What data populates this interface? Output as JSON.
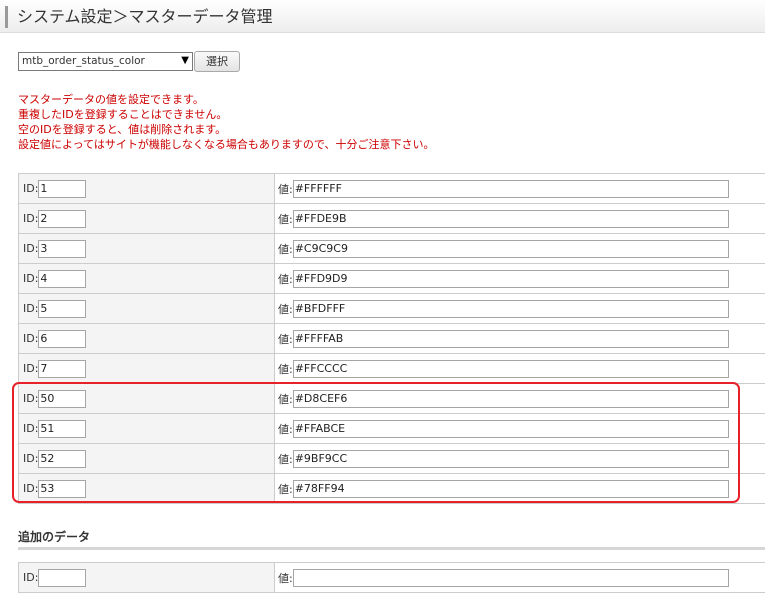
{
  "header": {
    "title": "システム設定＞マスターデータ管理"
  },
  "master_select": {
    "selected": "mtb_order_status_color",
    "button_label": "選択"
  },
  "notice": {
    "lines": [
      "マスターデータの値を設定できます。",
      "重複したIDを登録することはできません。",
      "空のIDを登録すると、値は削除されます。",
      "設定値によってはサイトが機能しなくなる場合もありますので、十分ご注意下さい。"
    ]
  },
  "labels": {
    "id": "ID:",
    "value": "値:"
  },
  "rows": [
    {
      "id": "1",
      "value": "#FFFFFF"
    },
    {
      "id": "2",
      "value": "#FFDE9B"
    },
    {
      "id": "3",
      "value": "#C9C9C9"
    },
    {
      "id": "4",
      "value": "#FFD9D9"
    },
    {
      "id": "5",
      "value": "#BFDFFF"
    },
    {
      "id": "6",
      "value": "#FFFFAB"
    },
    {
      "id": "7",
      "value": "#FFCCCC"
    },
    {
      "id": "50",
      "value": "#D8CEF6"
    },
    {
      "id": "51",
      "value": "#FFABCE"
    },
    {
      "id": "52",
      "value": "#9BF9CC"
    },
    {
      "id": "53",
      "value": "#78FF94"
    }
  ],
  "add_section": {
    "title": "追加のデータ",
    "id": "",
    "value": ""
  },
  "colors": {
    "notice": "#cc0000",
    "highlight": "#e8202a",
    "id_column_bg": "#f4f4f4"
  }
}
